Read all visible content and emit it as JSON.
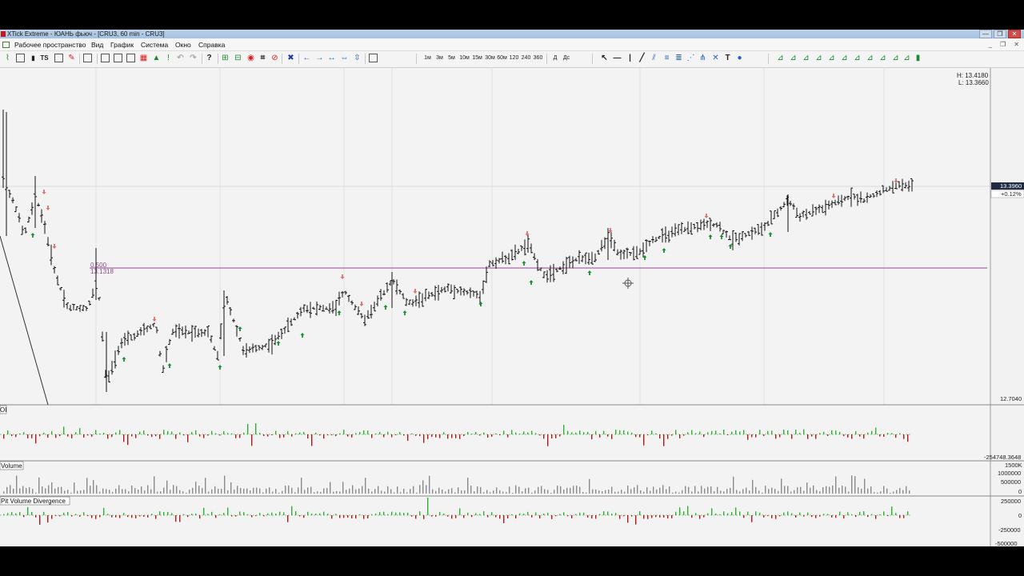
{
  "window": {
    "title": "XTick Extreme - ЮАНЬ фьюч - [CRU3, 60 min - CRU3]",
    "controls": [
      "—",
      "❐",
      "✕"
    ]
  },
  "menu": {
    "items": [
      "Рабочее пространство",
      "Вид",
      "График",
      "Система",
      "Окно",
      "Справка"
    ],
    "mdi_controls": [
      "_",
      "❐",
      "✕"
    ]
  },
  "toolbar": {
    "timeframes": [
      "1м",
      "3м",
      "5м",
      "10м",
      "15м",
      "30м",
      "60м",
      "120",
      "240",
      "360"
    ],
    "extra": [
      "Д",
      "Дс"
    ]
  },
  "chart": {
    "high_label": "H: 13.4180",
    "low_label": "L: 13.3660",
    "last_price": "13.3960",
    "change": "+0.12%",
    "fib_level": "0.500",
    "fib_price": "13.1318",
    "price_axis_bottom": "12.7040",
    "colors": {
      "up_arrow": "#1a8f2a",
      "down_arrow": "#e07070",
      "fib_line": "#8e4a8e",
      "last_price_bg": "#1f2a44"
    }
  },
  "panels": {
    "oi": {
      "label": "OI",
      "axis": [
        "-254748.3648"
      ]
    },
    "volume": {
      "label": "Volume",
      "axis": [
        "1500K",
        "1000000",
        "500000",
        "0"
      ]
    },
    "pvd": {
      "label": "Pit Volume Divergence",
      "axis": [
        "250000",
        "0",
        "-250000",
        "-500000"
      ]
    }
  }
}
